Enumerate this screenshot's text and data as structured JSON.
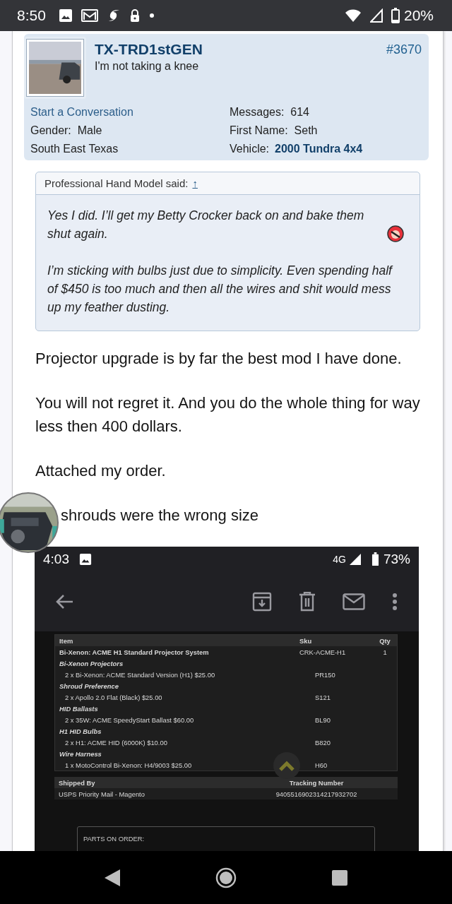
{
  "status_bar": {
    "time": "8:50",
    "battery": "20%"
  },
  "post": {
    "user": {
      "name": "TX-TRD1stGEN",
      "title": "I'm not taking a knee",
      "post_number": "#3670",
      "left_fields": [
        {
          "kind": "link",
          "text": "Start a Conversation"
        },
        {
          "kind": "field",
          "label": "Gender:",
          "value": "Male"
        },
        {
          "kind": "plain",
          "text": "South East Texas"
        }
      ],
      "right_fields": [
        {
          "kind": "field",
          "label": "Messages:",
          "value": "614"
        },
        {
          "kind": "field",
          "label": "First Name:",
          "value": "Seth"
        },
        {
          "kind": "linkfield",
          "label": "Vehicle:",
          "value": "2000 Tundra 4x4"
        }
      ]
    },
    "quote": {
      "attribution": "Professional Hand Model said:",
      "jump": "↑",
      "paragraphs": [
        {
          "text": "Yes I did. I’ll get my Betty Crocker back on and bake them shut again.",
          "emoji": true
        },
        {
          "text": "I’m sticking with bulbs just due to simplicity. Even spending half of $450 is too much and then all the wires and shit would mess up my feather dusting.",
          "emoji": false
        }
      ]
    },
    "body": [
      "Projector upgrade is by far the best mod I have done.",
      "You will not regret it. And you do the whole thing for way less then 400 dollars.",
      "Attached my order.",
      "shrouds were the wrong size"
    ],
    "attachment": {
      "status_bar": {
        "time": "4:03",
        "network": "4G",
        "battery": "73%"
      },
      "order_table": {
        "columns": [
          "Item",
          "Sku",
          "Qty"
        ],
        "rows": [
          {
            "kind": "item",
            "item": "Bi-Xenon: ACME H1 Standard Projector System",
            "sku": "CRK-ACME-H1",
            "qty": "1"
          },
          {
            "kind": "group",
            "item": "Bi-Xenon Projectors"
          },
          {
            "kind": "option",
            "item": "2 x Bi-Xenon: ACME Standard Version (H1) $25.00",
            "sku": "PR150"
          },
          {
            "kind": "group",
            "item": "Shroud Preference"
          },
          {
            "kind": "option",
            "item": "2 x Apollo 2.0 Flat (Black) $25.00",
            "sku": "S121"
          },
          {
            "kind": "group",
            "item": "HID Ballasts"
          },
          {
            "kind": "option",
            "item": "2 x 35W: ACME SpeedyStart Ballast $60.00",
            "sku": "BL90"
          },
          {
            "kind": "group",
            "item": "H1 HID Bulbs"
          },
          {
            "kind": "option",
            "item": "2 x H1: ACME HID (6000K) $10.00",
            "sku": "B820"
          },
          {
            "kind": "group",
            "item": "Wire Harness"
          },
          {
            "kind": "option",
            "item": "1 x MotoControl Bi-Xenon: H4/9003 $25.00",
            "sku": "H60"
          }
        ]
      },
      "shipping": {
        "columns": [
          "Shipped By",
          "Tracking Number"
        ],
        "row": [
          "USPS Priority Mail - Magento",
          "9405516902314217932702"
        ]
      },
      "parts_label": "PARTS ON ORDER:"
    }
  }
}
